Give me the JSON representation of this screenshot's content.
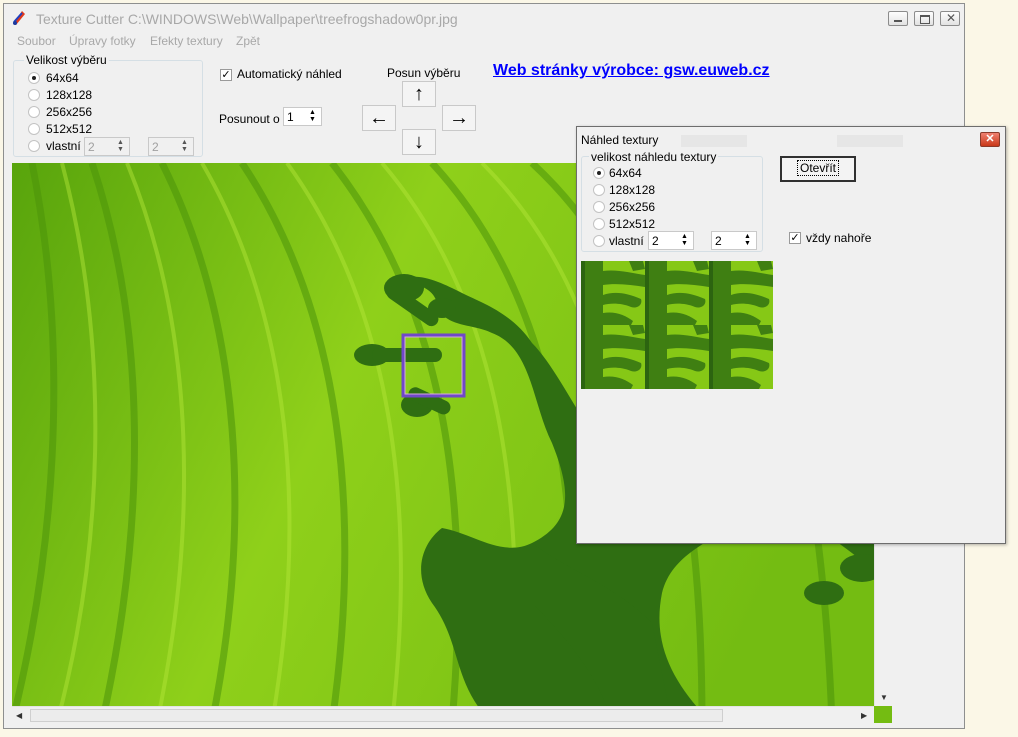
{
  "window": {
    "title": "Texture Cutter C:\\WINDOWS\\Web\\Wallpaper\\treefrogshadow0pr.jpg"
  },
  "menu": [
    "Soubor",
    "Úpravy fotky",
    "Efekty textury",
    "Zpět"
  ],
  "selection_size": {
    "legend": "Velikost výběru",
    "options": [
      "64x64",
      "128x128",
      "256x256",
      "512x512",
      "vlastní"
    ],
    "selected": "64x64",
    "custom_width": "2",
    "custom_height": "2"
  },
  "auto_preview": {
    "label": "Automatický náhled",
    "checked": true
  },
  "shift": {
    "label": "Posunout o",
    "value": "1"
  },
  "move_selection": {
    "label": "Posun výběru",
    "up": "↑",
    "left": "←",
    "right": "→",
    "down": "↓"
  },
  "web_link": "Web stránky výrobce: gsw.euweb.cz",
  "dialog": {
    "title": "Náhled textury",
    "close_glyph": "✕",
    "group_legend": "velikost náhledu textury",
    "options": [
      "64x64",
      "128x128",
      "256x256",
      "512x512",
      "vlastní"
    ],
    "selected": "64x64",
    "custom_width": "2",
    "custom_height": "2",
    "open_button": "Otevřít",
    "always_on_top": {
      "label": "vždy nahoře",
      "checked": true
    }
  },
  "colors": {
    "leaf_dark": "#4e9a0a",
    "leaf_light": "#9ad81e",
    "frog_shadow": "#2f6e12",
    "selection_border": "#7048c8",
    "link": "#0000ff"
  }
}
